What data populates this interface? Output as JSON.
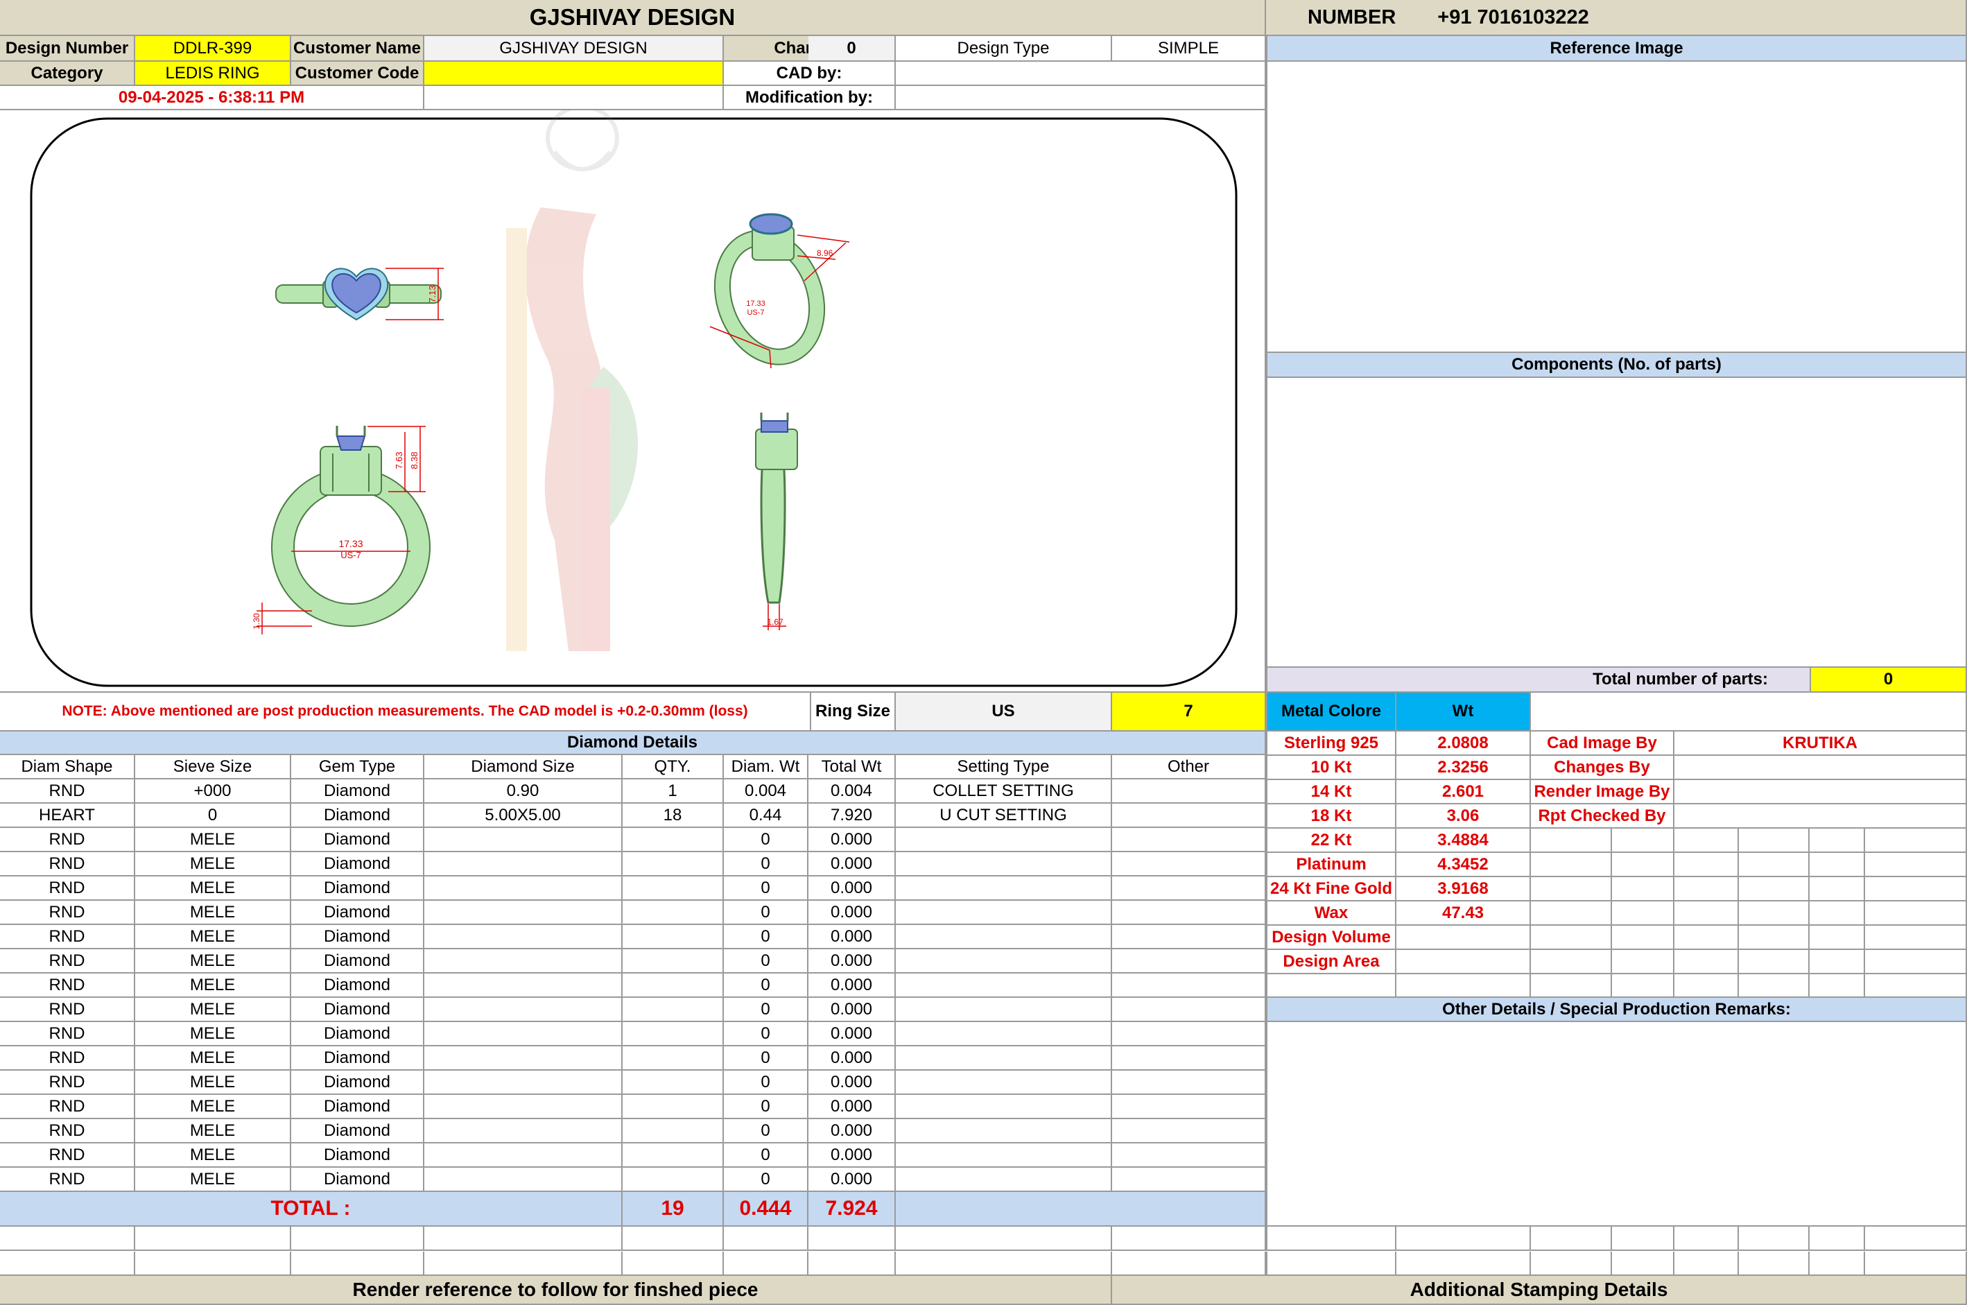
{
  "header": {
    "title": "GJSHIVAY DESIGN",
    "number_label": "NUMBER",
    "number_value": "+91 7016103222"
  },
  "info": {
    "design_number_label": "Design Number",
    "design_number": "DDLR-399",
    "customer_name_label": "Customer Name",
    "customer_name": "GJSHIVAY DESIGN",
    "changes_label": "Changes",
    "changes": "0",
    "design_type_label": "Design Type",
    "design_type": "SIMPLE",
    "category_label": "Category",
    "category": "LEDIS RING",
    "customer_code_label": "Customer Code",
    "customer_code": "",
    "cad_by_label": "CAD by:",
    "cad_by": "",
    "datetime": "09-04-2025 - 6:38:11 PM",
    "modification_label": "Modification by:",
    "modification_by": ""
  },
  "drawing": {
    "dims": {
      "top_height": "7.13",
      "front_h1": "7.63",
      "front_h2": "8.38",
      "inner_size": "17.33",
      "us_size": "US-7",
      "shank_thk": "1.30",
      "side_w": "1.67",
      "persp_a": "8.96",
      "persp_size": "17.33",
      "persp_us": "US-7"
    }
  },
  "right_panel": {
    "reference_image_title": "Reference Image",
    "components_title": "Components (No. of parts)",
    "total_parts_label": "Total number of parts:",
    "total_parts_value": "0"
  },
  "note": {
    "text": "NOTE: Above mentioned are post production measurements. The CAD model is +0.2-0.30mm (loss)",
    "ring_size_label": "Ring Size",
    "ring_size_unit": "US",
    "ring_size_value": "7"
  },
  "diamond": {
    "title": "Diamond Details",
    "headers": [
      "Diam Shape",
      "Sieve Size",
      "Gem Type",
      "Diamond Size",
      "QTY.",
      "Diam. Wt",
      "Total Wt",
      "Setting Type",
      "Other"
    ],
    "rows": [
      [
        "RND",
        "+000",
        "Diamond",
        "0.90",
        "1",
        "0.004",
        "0.004",
        "COLLET SETTING",
        ""
      ],
      [
        "HEART",
        "0",
        "Diamond",
        "5.00X5.00",
        "18",
        "0.44",
        "7.920",
        "U CUT SETTING",
        ""
      ],
      [
        "RND",
        "MELE",
        "Diamond",
        "",
        "",
        "0",
        "0.000",
        "",
        ""
      ],
      [
        "RND",
        "MELE",
        "Diamond",
        "",
        "",
        "0",
        "0.000",
        "",
        ""
      ],
      [
        "RND",
        "MELE",
        "Diamond",
        "",
        "",
        "0",
        "0.000",
        "",
        ""
      ],
      [
        "RND",
        "MELE",
        "Diamond",
        "",
        "",
        "0",
        "0.000",
        "",
        ""
      ],
      [
        "RND",
        "MELE",
        "Diamond",
        "",
        "",
        "0",
        "0.000",
        "",
        ""
      ],
      [
        "RND",
        "MELE",
        "Diamond",
        "",
        "",
        "0",
        "0.000",
        "",
        ""
      ],
      [
        "RND",
        "MELE",
        "Diamond",
        "",
        "",
        "0",
        "0.000",
        "",
        ""
      ],
      [
        "RND",
        "MELE",
        "Diamond",
        "",
        "",
        "0",
        "0.000",
        "",
        ""
      ],
      [
        "RND",
        "MELE",
        "Diamond",
        "",
        "",
        "0",
        "0.000",
        "",
        ""
      ],
      [
        "RND",
        "MELE",
        "Diamond",
        "",
        "",
        "0",
        "0.000",
        "",
        ""
      ],
      [
        "RND",
        "MELE",
        "Diamond",
        "",
        "",
        "0",
        "0.000",
        "",
        ""
      ],
      [
        "RND",
        "MELE",
        "Diamond",
        "",
        "",
        "0",
        "0.000",
        "",
        ""
      ],
      [
        "RND",
        "MELE",
        "Diamond",
        "",
        "",
        "0",
        "0.000",
        "",
        ""
      ],
      [
        "RND",
        "MELE",
        "Diamond",
        "",
        "",
        "0",
        "0.000",
        "",
        ""
      ],
      [
        "RND",
        "MELE",
        "Diamond",
        "",
        "",
        "0",
        "0.000",
        "",
        ""
      ]
    ],
    "total_label": "TOTAL :",
    "total_qty": "19",
    "total_diam_wt": "0.444",
    "total_wt": "7.924"
  },
  "metal": {
    "header_label": "Metal Colore",
    "header_wt": "Wt",
    "rows": [
      [
        "Sterling 925",
        "2.0808"
      ],
      [
        "10 Kt",
        "2.3256"
      ],
      [
        "14 Kt",
        "2.601"
      ],
      [
        "18 Kt",
        "3.06"
      ],
      [
        "22 Kt",
        "3.4884"
      ],
      [
        "Platinum",
        "4.3452"
      ],
      [
        "24 Kt Fine Gold",
        "3.9168"
      ],
      [
        "Wax",
        "47.43"
      ],
      [
        "Design Volume",
        ""
      ],
      [
        "Design Area",
        ""
      ]
    ]
  },
  "credits": {
    "rows": [
      [
        "Cad Image By",
        "KRUTIKA"
      ],
      [
        "Changes By",
        ""
      ],
      [
        "Render Image By",
        ""
      ],
      [
        "Rpt Checked By",
        ""
      ]
    ]
  },
  "remarks": {
    "title": "Other Details / Special Production Remarks:"
  },
  "footer": {
    "render_reference": "Render reference to follow for finshed piece",
    "stamping": "Additional Stamping Details"
  },
  "colors": {
    "ring_metal": "#b8e6b0",
    "gem": "#7b8fd8",
    "dimension": "#e00000"
  }
}
